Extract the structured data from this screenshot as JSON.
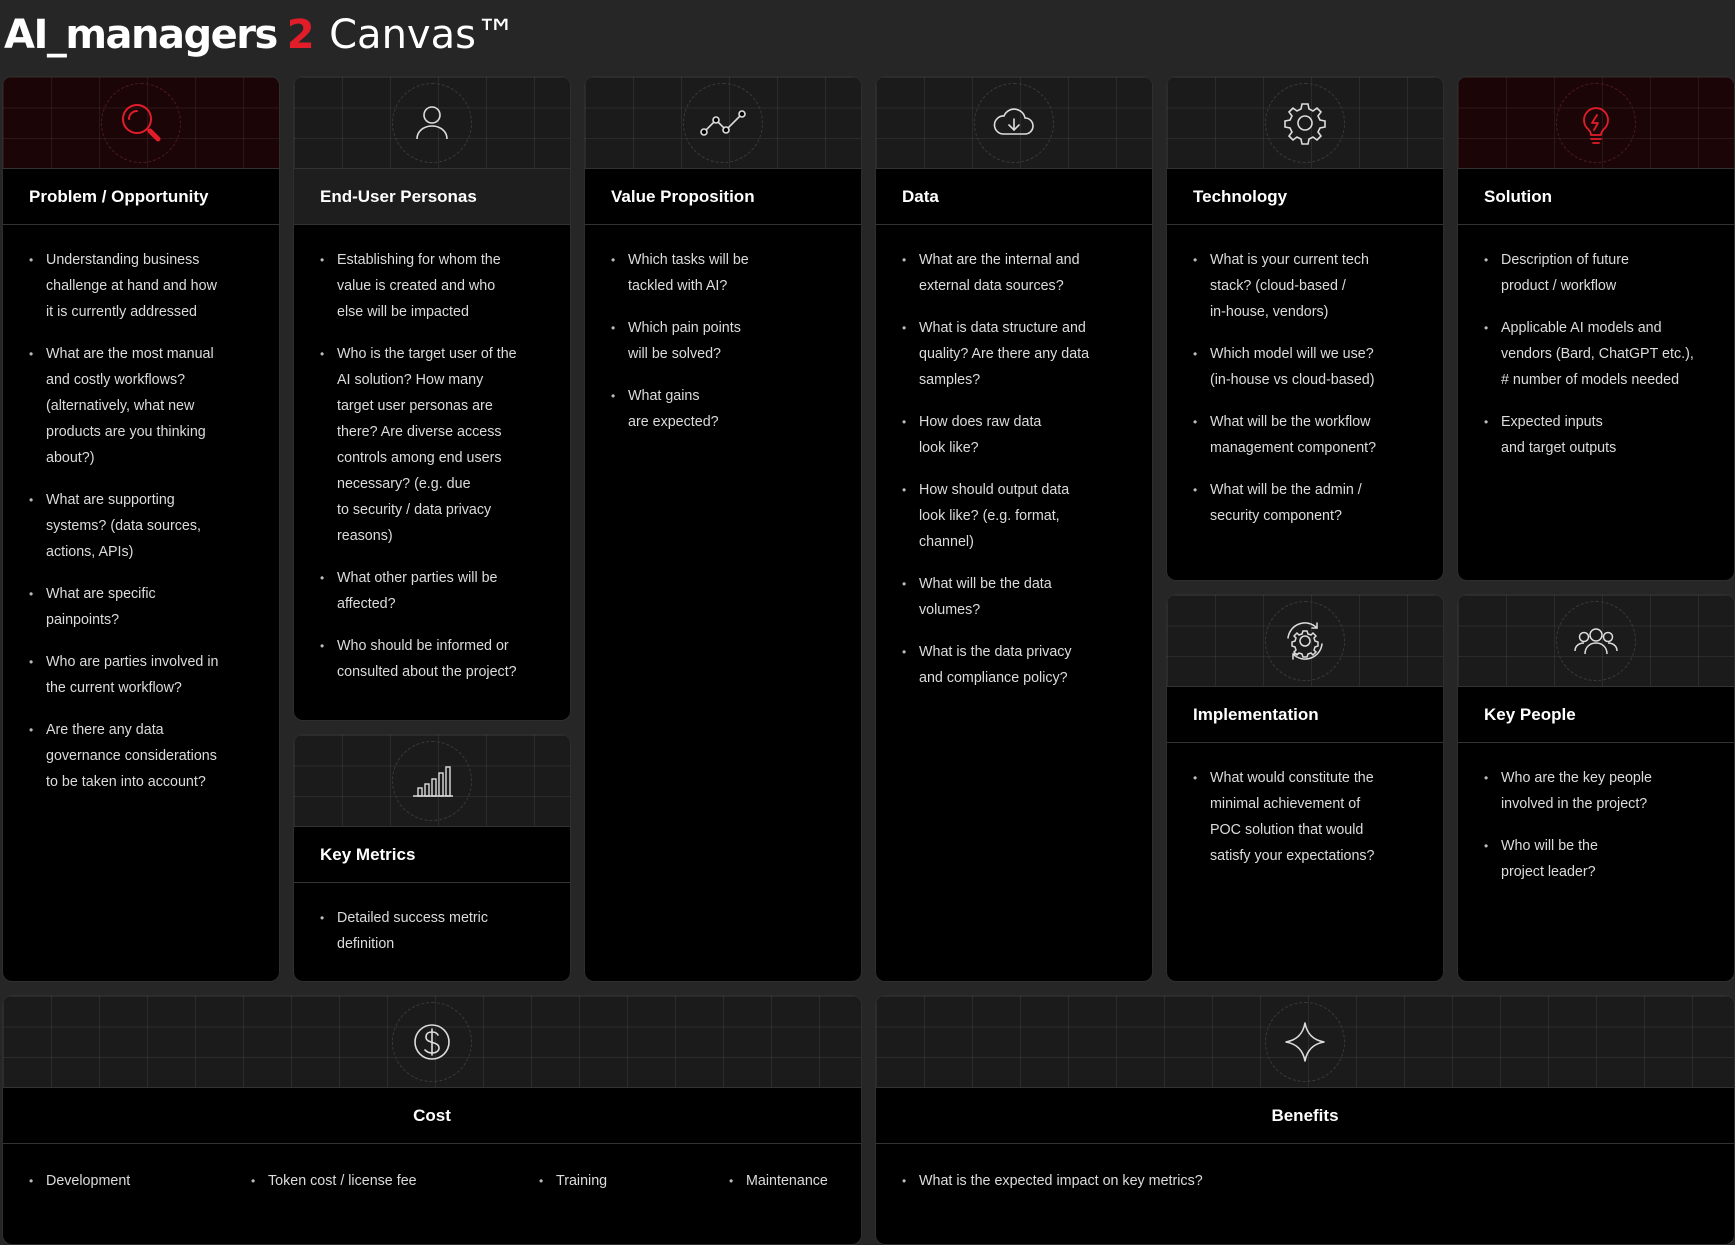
{
  "header": {
    "brand": "AI_managers",
    "accent": "2",
    "canvas": "Canvas™"
  },
  "colors": {
    "accent": "#e11d2a",
    "background": "#262626",
    "panel": "#000000"
  },
  "panels": {
    "problem": {
      "icon": "magnifier-icon",
      "title": "Problem / Opportunity",
      "items": [
        "Understanding business\nchallenge at hand and how\nit is currently addressed",
        "What are the most manual\nand costly workflows?\n(alternatively, what new\nproducts are you thinking\nabout?)",
        "What are supporting\nsystems? (data sources,\nactions, APIs)",
        "What are specific\npainpoints?",
        "Who are parties involved in\nthe current workflow?",
        "Are there any data\ngovernance considerations\nto be taken into account?"
      ]
    },
    "personas": {
      "icon": "person-icon",
      "title": "End-User Personas",
      "items": [
        "Establishing for whom the\nvalue is created and who\nelse will be impacted",
        "Who is the target user of the\nAI solution? How many\ntarget user personas are\nthere? Are diverse access\ncontrols among end users\nnecessary? (e.g. due\nto security / data privacy\nreasons)",
        "What other parties will be\naffected?",
        "Who should be informed or\nconsulted about the project?"
      ]
    },
    "metrics": {
      "icon": "bar-chart-icon",
      "title": "Key Metrics",
      "items": [
        "Detailed success metric\ndefinition"
      ]
    },
    "value": {
      "icon": "line-graph-icon",
      "title": "Value Proposition",
      "items": [
        "Which tasks will be\ntackled with AI?",
        "Which pain points\nwill be solved?",
        "What gains\nare expected?"
      ]
    },
    "data": {
      "icon": "cloud-download-icon",
      "title": "Data",
      "items": [
        "What are the internal and\nexternal data sources?",
        "What is data structure and\nquality? Are there any data\nsamples?",
        "How does raw data\nlook like?",
        "How should output data\nlook like? (e.g. format,\nchannel)",
        "What will be the data\nvolumes?",
        "What is the data privacy\nand compliance policy?"
      ]
    },
    "technology": {
      "icon": "gear-icon",
      "title": "Technology",
      "items": [
        "What is your current tech\nstack? (cloud-based /\nin-house, vendors)",
        "Which model will we use?\n(in-house vs cloud-based)",
        "What will be the workflow\nmanagement component?",
        "What will be the admin /\nsecurity component?"
      ]
    },
    "implementation": {
      "icon": "gear-cycle-icon",
      "title": "Implementation",
      "items": [
        "What would constitute the\nminimal achievement of\nPOC solution that would\nsatisfy your expectations?"
      ]
    },
    "solution": {
      "icon": "lightbulb-icon",
      "title": "Solution",
      "items": [
        "Description of future\nproduct / workflow",
        "Applicable AI models and\nvendors (Bard, ChatGPT etc.),\n# number of models needed",
        "Expected inputs\nand target outputs"
      ]
    },
    "people": {
      "icon": "people-icon",
      "title": "Key People",
      "items": [
        "Who are the key people\ninvolved in the project?",
        "Who will be the\nproject leader?"
      ]
    },
    "cost": {
      "icon": "dollar-coin-icon",
      "title": "Cost",
      "items": [
        "Development",
        "Token cost / license fee",
        "Training",
        "Maintenance"
      ]
    },
    "benefits": {
      "icon": "sparkle-icon",
      "title": "Benefits",
      "items": [
        "What is the expected impact on key metrics?"
      ]
    }
  }
}
